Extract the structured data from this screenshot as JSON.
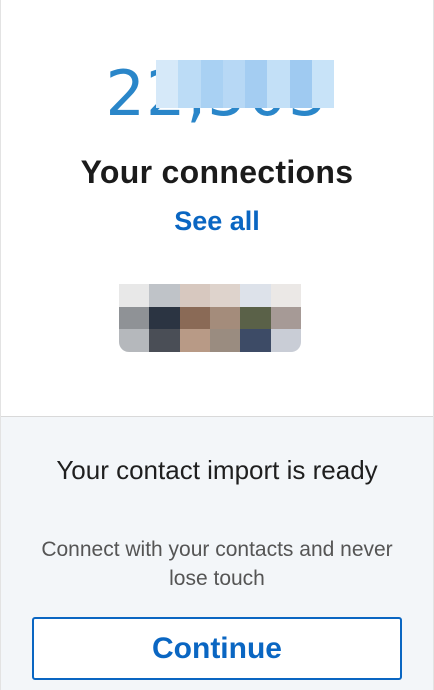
{
  "connections": {
    "count_visible": "22,505",
    "title": "Your connections",
    "see_all_label": "See all"
  },
  "contact_import": {
    "heading": "Your contact import is ready",
    "subtext": "Connect with your contacts and never lose touch",
    "continue_label": "Continue"
  },
  "colors": {
    "accent": "#0a66c2",
    "count": "#2a86c9",
    "bottom_bg": "#f3f6f9"
  }
}
